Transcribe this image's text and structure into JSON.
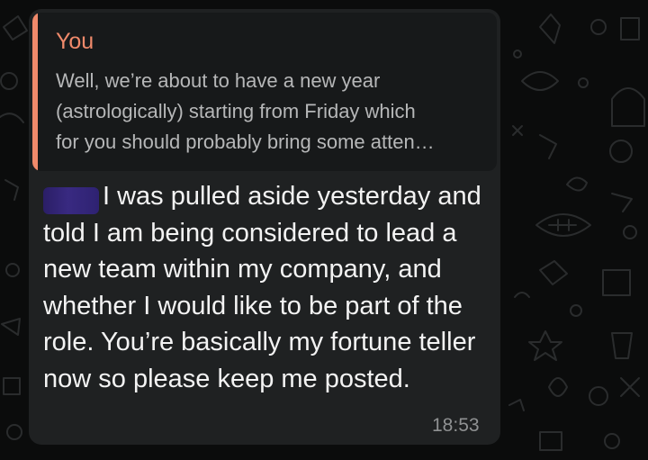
{
  "quote": {
    "author": "You",
    "text": "Well, we’re about to have a new year\n(astrologically) starting from Friday which\nfor you should probably bring some atten…"
  },
  "message": {
    "text": "I was pulled aside yesterday and told I am being considered to lead a new team within my company, and whether I would like to be part of the role. You’re basically my fortune teller now so please keep me posted.",
    "time": "18:53"
  },
  "colors": {
    "quote_accent": "#f08a6b",
    "bubble": "#1f2122",
    "background": "#0b0c0c"
  },
  "icons": [
    "chat-wallpaper-doodles",
    "redacted-name-scribble"
  ]
}
